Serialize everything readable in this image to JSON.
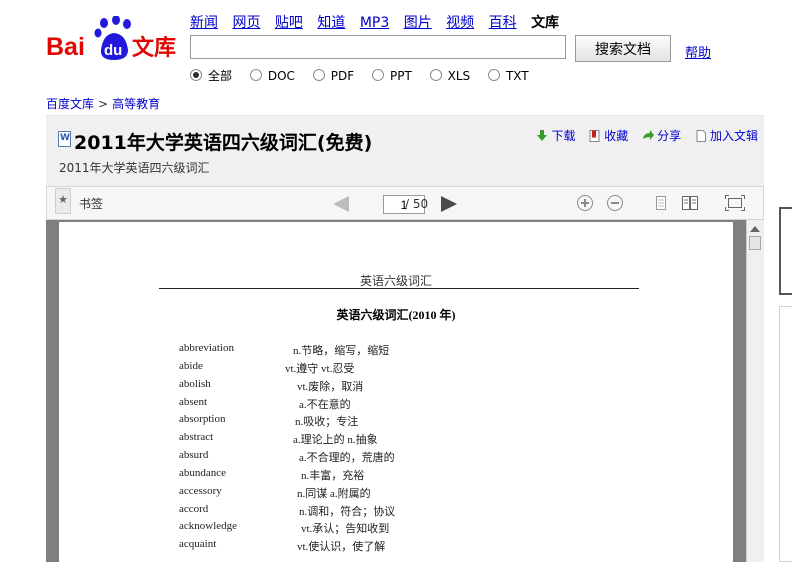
{
  "logo": {
    "text_bai": "Bai",
    "text_du": "du",
    "text_wenku": "文库"
  },
  "nav": {
    "items": [
      "新闻",
      "网页",
      "贴吧",
      "知道",
      "MP3",
      "图片",
      "视频",
      "百科"
    ],
    "current": "文库"
  },
  "search": {
    "value": "",
    "button_label": "搜索文档",
    "help_label": "帮助"
  },
  "filetypes": {
    "selected": "全部",
    "options": [
      "全部",
      "DOC",
      "PDF",
      "PPT",
      "XLS",
      "TXT"
    ]
  },
  "breadcrumb": {
    "root": "百度文库",
    "separator": ">",
    "category": "高等教育"
  },
  "document": {
    "title": "2011年大学英语四六级词汇(免费)",
    "subtitle": "2011年大学英语四六级词汇"
  },
  "actions": {
    "download": "下载",
    "favorite": "收藏",
    "share": "分享",
    "add_to_library": "加入文辑"
  },
  "toolbar": {
    "bookmark_label": "书签",
    "current_page": "1",
    "total_pages": "/ 50"
  },
  "page": {
    "header": "英语六级词汇",
    "heading": "英语六级词汇(2010 年)",
    "vocab": [
      {
        "word": "abbreviation",
        "def": "n.节略，缩写，缩短"
      },
      {
        "word": "abide",
        "def": "vt.遵守  vt.忍受"
      },
      {
        "word": "abolish",
        "def": "vt.废除，取消"
      },
      {
        "word": "absent",
        "def": "a.不在意的"
      },
      {
        "word": "absorption",
        "def": "n.吸收；专注"
      },
      {
        "word": "abstract",
        "def": "a.理论上的  n.抽象"
      },
      {
        "word": "absurd",
        "def": "a.不合理的，荒唐的"
      },
      {
        "word": "abundance",
        "def": "n.丰富，充裕"
      },
      {
        "word": "accessory",
        "def": "n.同谋  a.附属的"
      },
      {
        "word": "accord",
        "def": "n.调和，符合；协议"
      },
      {
        "word": "acknowledge",
        "def": "vt.承认；告知收到"
      },
      {
        "word": "acquaint",
        "def": "vt.使认识，使了解"
      }
    ]
  },
  "colors": {
    "logo_red": "#e10601",
    "logo_blue": "#2319dc",
    "link": "#0000cc",
    "header_bg": "#f0f0f0",
    "viewer_bg": "#7f7f7f",
    "action_green": "#3a9a2a",
    "action_red": "#c8201f"
  }
}
